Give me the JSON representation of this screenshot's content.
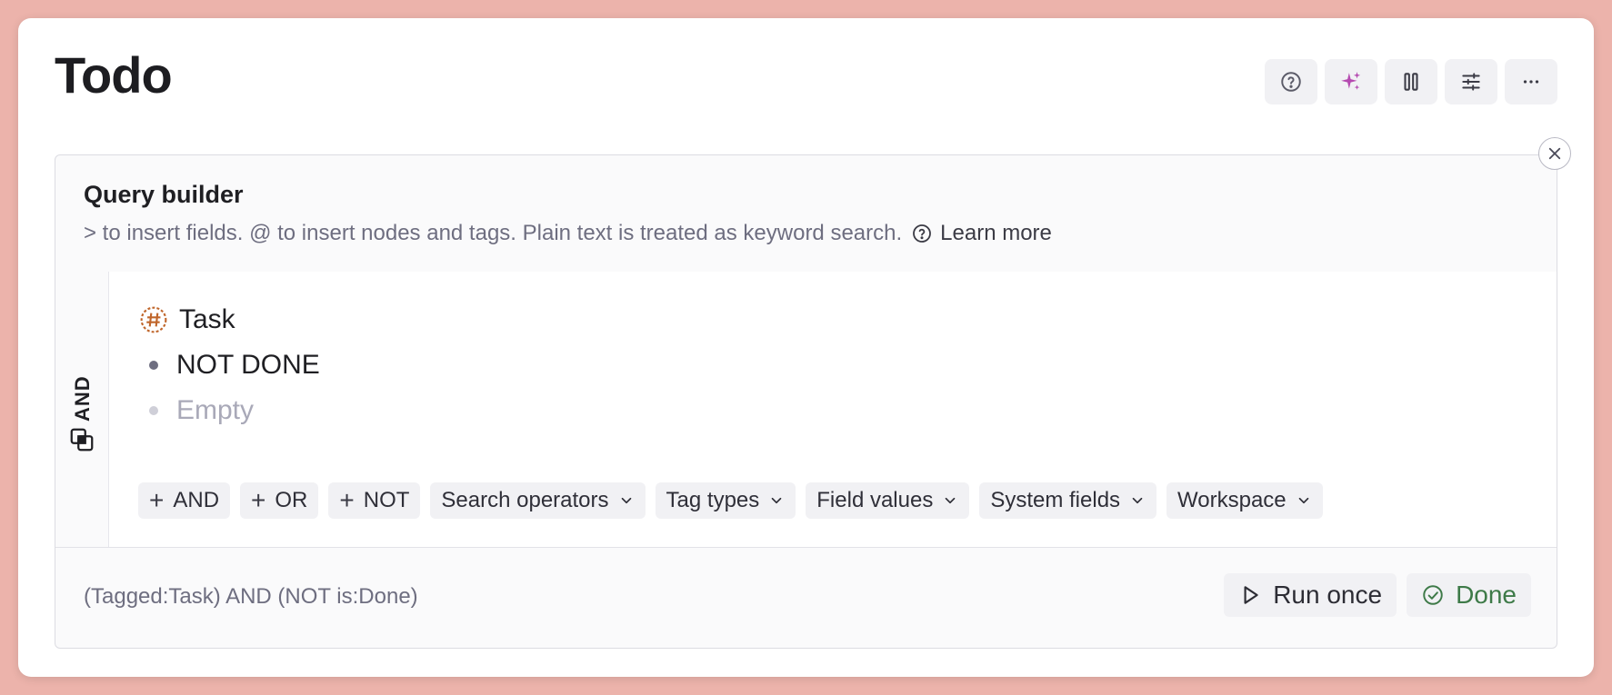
{
  "page": {
    "title": "Todo"
  },
  "toolbar": {
    "buttons": [
      {
        "icon": "help-circle-icon"
      },
      {
        "icon": "sparkles-icon",
        "color": "#b54ab0"
      },
      {
        "icon": "columns-icon"
      },
      {
        "icon": "sliders-icon"
      },
      {
        "icon": "ellipsis-icon"
      }
    ]
  },
  "query_builder": {
    "title": "Query builder",
    "hint": "> to insert fields. @ to insert nodes and tags. Plain text is treated as keyword search.",
    "learn_more": "Learn more",
    "group_operator": "AND",
    "conditions": [
      {
        "label": "Task",
        "icon": "tag-hash-icon",
        "icon_color": "#c0662b"
      },
      {
        "label": "NOT DONE"
      },
      {
        "label": "Empty",
        "placeholder": true
      }
    ],
    "chips": {
      "add_and": "AND",
      "add_or": "OR",
      "add_not": "NOT",
      "search_operators": "Search operators",
      "tag_types": "Tag types",
      "field_values": "Field values",
      "system_fields": "System fields",
      "workspace": "Workspace"
    },
    "expression": "(Tagged:Task) AND (NOT is:Done)",
    "run_once": "Run once",
    "done": "Done"
  },
  "colors": {
    "background": "#ecb3ab",
    "done_green": "#3e7a48",
    "tag_orange": "#c0662b"
  }
}
